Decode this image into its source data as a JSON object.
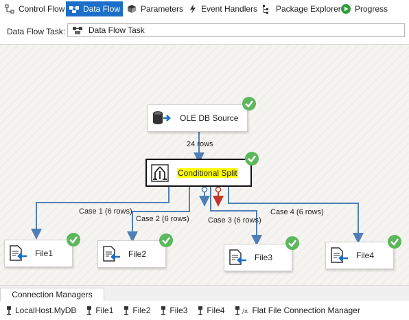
{
  "tabs": [
    {
      "label": "Control Flow",
      "icon": "control-flow-icon",
      "active": false
    },
    {
      "label": "Data Flow",
      "icon": "data-flow-icon",
      "active": true
    },
    {
      "label": "Parameters",
      "icon": "parameters-icon",
      "active": false
    },
    {
      "label": "Event Handlers",
      "icon": "event-handlers-icon",
      "active": false
    },
    {
      "label": "Package Explorer",
      "icon": "package-explorer-icon",
      "active": false
    },
    {
      "label": "Progress",
      "icon": "progress-icon",
      "active": false
    }
  ],
  "task": {
    "label": "Data Flow Task:",
    "value": "Data Flow Task"
  },
  "components": {
    "source": {
      "label": "OLE DB Source",
      "icon": "database-source-icon"
    },
    "split": {
      "label": "Conditional Split",
      "icon": "conditional-split-icon"
    },
    "files": [
      {
        "label": "File1",
        "icon": "flat-file-destination-icon"
      },
      {
        "label": "File2",
        "icon": "flat-file-destination-icon"
      },
      {
        "label": "File3",
        "icon": "flat-file-destination-icon"
      },
      {
        "label": "File4",
        "icon": "flat-file-destination-icon"
      }
    ]
  },
  "paths": {
    "source_to_split": "24 rows",
    "cases": [
      "Case 1 (6 rows)",
      "Case 2 (6 rows)",
      "Case 3 (6 rows)",
      "Case 4 (6 rows)"
    ]
  },
  "connection_managers": {
    "header": "Connection Managers",
    "items": [
      {
        "label": "LocalHost.MyDB",
        "icon": "connection-icon"
      },
      {
        "label": "File1",
        "icon": "connection-icon"
      },
      {
        "label": "File2",
        "icon": "connection-icon"
      },
      {
        "label": "File3",
        "icon": "connection-icon"
      },
      {
        "label": "File4",
        "icon": "connection-icon"
      },
      {
        "label": "Flat File Connection Manager",
        "icon": "connection-icon"
      }
    ]
  },
  "colors": {
    "accent": "#1c6fc9",
    "success": "#5cb85c",
    "path": "#4f7fb5",
    "error_path": "#c0392b",
    "highlight": "#ffff00"
  }
}
